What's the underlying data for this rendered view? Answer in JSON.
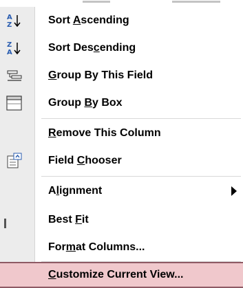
{
  "menu": {
    "items": [
      {
        "pre": "Sort ",
        "u": "A",
        "post": "scending",
        "icon": "sort-ascending-icon"
      },
      {
        "pre": "Sort Des",
        "u": "c",
        "post": "ending",
        "icon": "sort-descending-icon"
      },
      {
        "pre": "",
        "u": "G",
        "post": "roup By This Field",
        "icon": "group-by-field-icon"
      },
      {
        "pre": "Group ",
        "u": "B",
        "post": "y Box",
        "icon": "group-by-box-icon"
      },
      {
        "pre": "",
        "u": "R",
        "post": "emove This Column",
        "icon": ""
      },
      {
        "pre": "Field ",
        "u": "C",
        "post": "hooser",
        "icon": "field-chooser-icon"
      },
      {
        "pre": "A",
        "u": "l",
        "post": "ignment",
        "icon": "",
        "submenu": true
      },
      {
        "pre": "Best ",
        "u": "F",
        "post": "it",
        "icon": ""
      },
      {
        "pre": "For",
        "u": "m",
        "post": "at Columns...",
        "icon": ""
      },
      {
        "pre": "",
        "u": "C",
        "post": "ustomize Current View...",
        "icon": "",
        "highlighted": true
      }
    ]
  },
  "colors": {
    "highlight_bg": "#f0c8cc",
    "highlight_border": "#8e5a64",
    "gutter": "#ececec",
    "text": "#000000"
  }
}
